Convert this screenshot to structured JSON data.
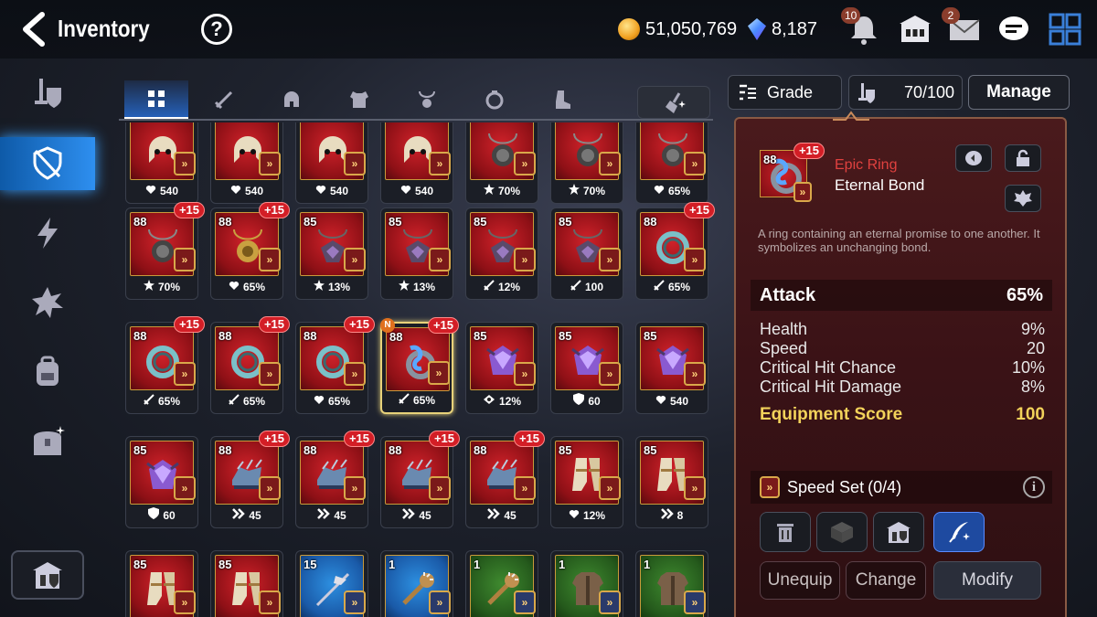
{
  "header": {
    "title": "Inventory",
    "help_label": "?",
    "gold": "51,050,769",
    "gems": "8,187",
    "notif_count": "10",
    "mail_count": "2"
  },
  "tabs": [
    "all",
    "weapon",
    "helmet",
    "armor",
    "necklace",
    "ring",
    "boots"
  ],
  "sort": {
    "label": "Grade",
    "capacity": "70/100",
    "manage": "Manage"
  },
  "colors": {
    "accent": "#2e8ff0",
    "epic": "#e0413f",
    "score": "#f2d25a",
    "plus_badge": "#d31e26"
  },
  "grid": {
    "rows": [
      [
        {
          "lvl": "",
          "plus": "",
          "icon": "helmet",
          "stat_icon": "heart",
          "stat": "540"
        },
        {
          "lvl": "",
          "plus": "",
          "icon": "helmet",
          "stat_icon": "heart",
          "stat": "540"
        },
        {
          "lvl": "",
          "plus": "",
          "icon": "helmet",
          "stat_icon": "heart",
          "stat": "540"
        },
        {
          "lvl": "",
          "plus": "",
          "icon": "helmet",
          "stat_icon": "heart",
          "stat": "540"
        },
        {
          "lvl": "",
          "plus": "",
          "icon": "necklace",
          "stat_icon": "burst",
          "stat": "70%"
        },
        {
          "lvl": "",
          "plus": "",
          "icon": "necklace",
          "stat_icon": "burst",
          "stat": "70%"
        },
        {
          "lvl": "",
          "plus": "",
          "icon": "necklace",
          "stat_icon": "heart",
          "stat": "65%"
        }
      ],
      [
        {
          "lvl": "88",
          "plus": "+15",
          "icon": "necklace",
          "stat_icon": "burst",
          "stat": "70%"
        },
        {
          "lvl": "88",
          "plus": "+15",
          "icon": "necklace-gold",
          "stat_icon": "heart",
          "stat": "65%"
        },
        {
          "lvl": "85",
          "plus": "",
          "icon": "necklace-dark",
          "stat_icon": "burst",
          "stat": "13%"
        },
        {
          "lvl": "85",
          "plus": "",
          "icon": "necklace-dark",
          "stat_icon": "burst",
          "stat": "13%"
        },
        {
          "lvl": "85",
          "plus": "",
          "icon": "necklace-dark",
          "stat_icon": "sword",
          "stat": "12%"
        },
        {
          "lvl": "85",
          "plus": "",
          "icon": "necklace-dark",
          "stat_icon": "sword",
          "stat": "100"
        },
        {
          "lvl": "88",
          "plus": "+15",
          "icon": "ring-coil",
          "stat_icon": "sword",
          "stat": "65%"
        }
      ],
      [
        {
          "lvl": "88",
          "plus": "+15",
          "icon": "ring-coil",
          "stat_icon": "sword",
          "stat": "65%"
        },
        {
          "lvl": "88",
          "plus": "+15",
          "icon": "ring-coil",
          "stat_icon": "sword",
          "stat": "65%"
        },
        {
          "lvl": "88",
          "plus": "+15",
          "icon": "ring-coil",
          "stat_icon": "heart",
          "stat": "65%"
        },
        {
          "lvl": "88",
          "plus": "+15",
          "icon": "ring-blue",
          "stat_icon": "sword",
          "stat": "65%",
          "new": "N",
          "selected": true
        },
        {
          "lvl": "85",
          "plus": "",
          "icon": "gem",
          "stat_icon": "eye",
          "stat": "12%"
        },
        {
          "lvl": "85",
          "plus": "",
          "icon": "gem",
          "stat_icon": "shield",
          "stat": "60"
        },
        {
          "lvl": "85",
          "plus": "",
          "icon": "gem",
          "stat_icon": "heart",
          "stat": "540"
        }
      ],
      [
        {
          "lvl": "85",
          "plus": "",
          "icon": "gem",
          "stat_icon": "shield",
          "stat": "60"
        },
        {
          "lvl": "88",
          "plus": "+15",
          "icon": "boots-blue",
          "stat_icon": "speed",
          "stat": "45"
        },
        {
          "lvl": "88",
          "plus": "+15",
          "icon": "boots-blue",
          "stat_icon": "speed",
          "stat": "45"
        },
        {
          "lvl": "88",
          "plus": "+15",
          "icon": "boots-blue",
          "stat_icon": "speed",
          "stat": "45"
        },
        {
          "lvl": "88",
          "plus": "+15",
          "icon": "boots-blue",
          "stat_icon": "speed",
          "stat": "45"
        },
        {
          "lvl": "85",
          "plus": "",
          "icon": "boots-gold",
          "stat_icon": "heart",
          "stat": "12%"
        },
        {
          "lvl": "85",
          "plus": "",
          "icon": "boots-gold",
          "stat_icon": "speed",
          "stat": "8"
        }
      ],
      [
        {
          "lvl": "85",
          "plus": "",
          "icon": "boots-gold",
          "stat_icon": "",
          "stat": ""
        },
        {
          "lvl": "85",
          "plus": "",
          "icon": "boots-gold",
          "stat_icon": "",
          "stat": ""
        },
        {
          "lvl": "15",
          "plus": "",
          "icon": "halberd",
          "bg": "blue",
          "stat_icon": "",
          "stat": ""
        },
        {
          "lvl": "1",
          "plus": "",
          "icon": "club",
          "bg": "blue",
          "stat_icon": "",
          "stat": ""
        },
        {
          "lvl": "1",
          "plus": "",
          "icon": "club",
          "bg": "green",
          "stat_icon": "",
          "stat": ""
        },
        {
          "lvl": "1",
          "plus": "",
          "icon": "vest",
          "bg": "green",
          "stat_icon": "",
          "stat": ""
        },
        {
          "lvl": "1",
          "plus": "",
          "icon": "vest",
          "bg": "green",
          "stat_icon": "",
          "stat": ""
        }
      ]
    ]
  },
  "detail": {
    "level": "88",
    "plus": "+15",
    "grade": "Epic Ring",
    "name": "Eternal Bond",
    "description": "A ring containing an eternal promise to one another. It symbolizes an unchanging bond.",
    "main_stat": {
      "label": "Attack",
      "value": "65%"
    },
    "substats": [
      {
        "label": "Health",
        "value": "9%"
      },
      {
        "label": "Speed",
        "value": "20"
      },
      {
        "label": "Critical Hit Chance",
        "value": "10%"
      },
      {
        "label": "Critical Hit Damage",
        "value": "8%"
      }
    ],
    "score": {
      "label": "Equipment Score",
      "value": "100"
    },
    "set": {
      "label": "Speed Set",
      "count": "(0/4)"
    },
    "buttons": {
      "unequip": "Unequip",
      "change": "Change",
      "modify": "Modify"
    }
  }
}
